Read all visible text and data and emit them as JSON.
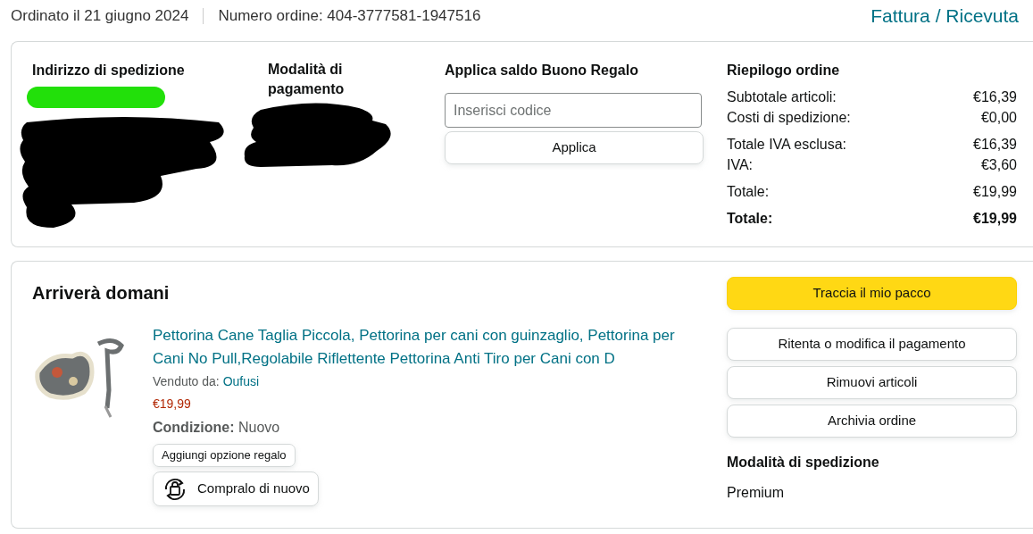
{
  "header": {
    "order_date": "Ordinato il 21 giugno 2024",
    "order_number": "Numero ordine: 404-3777581-1947516",
    "invoice_link": "Fattura / Ricevuta"
  },
  "summary_card": {
    "shipping_address": {
      "title": "Indirizzo di spedizione"
    },
    "payment_method": {
      "title": "Modalità di pagamento"
    },
    "gift_card": {
      "title": "Applica saldo Buono Regalo",
      "placeholder": "Inserisci codice",
      "button": "Applica"
    },
    "order_summary": {
      "title": "Riepilogo ordine",
      "rows": [
        {
          "label": "Subtotale articoli:",
          "value": "€16,39",
          "kind": "line"
        },
        {
          "label": "Costi di spedizione:",
          "value": "€0,00",
          "kind": "line"
        },
        {
          "label": "Totale IVA esclusa:",
          "value": "€16,39",
          "kind": "line"
        },
        {
          "label": "IVA:",
          "value": "€3,60",
          "kind": "line"
        },
        {
          "label": "Totale:",
          "value": "€19,99",
          "kind": "line"
        },
        {
          "label": "Totale:",
          "value": "€19,99",
          "kind": "grand"
        }
      ]
    }
  },
  "shipment_card": {
    "title": "Arriverà domani",
    "item": {
      "name": "Pettorina Cane Taglia Piccola, Pettorina per cani con guinzaglio, Pettorina per Cani No Pull,Regolabile Riflettente Pettorina Anti Tiro per Cani con D",
      "sold_by_label": "Venduto da:",
      "seller": "Oufusi",
      "price": "€19,99",
      "condition_label": "Condizione:",
      "condition": "Nuovo",
      "gift_button": "Aggiungi opzione regalo",
      "buy_again_button": "Compralo di nuovo"
    },
    "actions": [
      {
        "label": "Traccia il mio pacco",
        "kind": "primary"
      },
      {
        "label": "Ritenta o modifica il pagamento",
        "kind": "secondary"
      },
      {
        "label": "Rimuovi articoli",
        "kind": "secondary"
      },
      {
        "label": "Archivia ordine",
        "kind": "secondary"
      }
    ],
    "shipping_method": {
      "title": "Modalità di spedizione",
      "value": "Premium"
    }
  }
}
